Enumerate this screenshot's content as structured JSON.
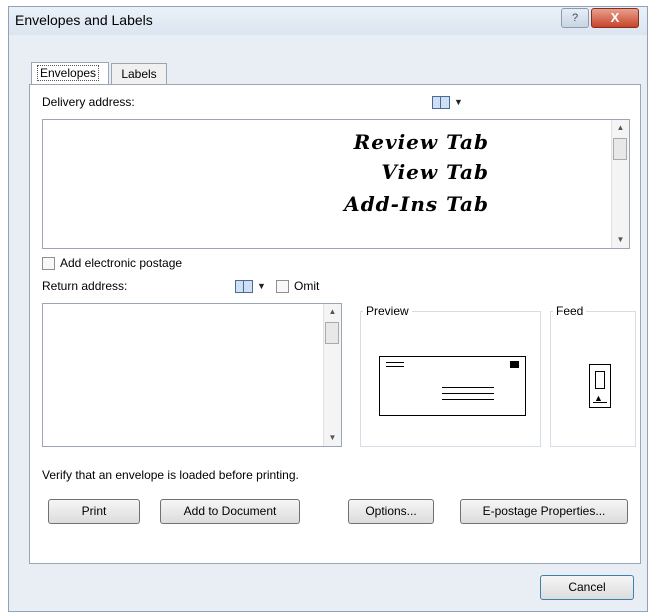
{
  "window": {
    "title": "Envelopes and Labels",
    "help_label": "?",
    "close_label": "X"
  },
  "tabs": [
    {
      "label": "Envelopes",
      "active": true
    },
    {
      "label": "Labels",
      "active": false
    }
  ],
  "delivery": {
    "label": "Delivery address:",
    "lines": [
      "Review Tab",
      "View Tab",
      "Add-Ins Tab"
    ]
  },
  "electronic_postage": {
    "label": "Add electronic postage",
    "checked": false
  },
  "return": {
    "label": "Return address:",
    "omit_label": "Omit",
    "omit_checked": false,
    "value": ""
  },
  "preview": {
    "title": "Preview"
  },
  "feed": {
    "title": "Feed"
  },
  "verify_text": "Verify that an envelope is loaded before printing.",
  "buttons": {
    "print": "Print",
    "add_to_document": "Add to Document",
    "options": "Options...",
    "epostage": "E-postage Properties...",
    "cancel": "Cancel"
  },
  "icons": {
    "address_book": "address-book-icon",
    "dropdown": "chevron-down-icon"
  }
}
